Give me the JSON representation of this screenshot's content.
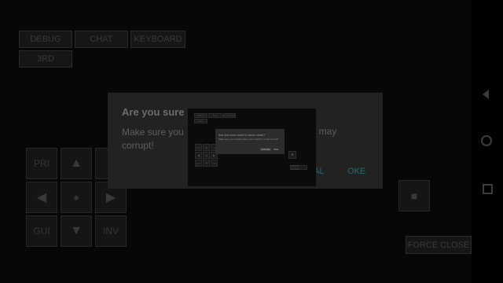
{
  "top_buttons": {
    "debug": "DEBUG",
    "chat": "CHAT",
    "keyboard": "KEYBOARD",
    "third_person": "3RD"
  },
  "dpad": {
    "pri": "PRI",
    "sec": "S",
    "gui": "GUI",
    "inv": "INV",
    "up": "▲",
    "down": "▼",
    "left": "◀",
    "right": "▶",
    "center": "◆"
  },
  "action_button_glyph": "■",
  "force_close_label": "FORCE CLOSE",
  "dialog": {
    "title": "Are you sure",
    "message": "Make sure you",
    "message_cont": "corrupt!",
    "message_tail": "t may",
    "cancel_label": "AL",
    "ok_label": "OKE"
  },
  "inner_dialog": {
    "title": "Are you sure want to force close?",
    "message": "Make sure you already close your world or it may corrupt!",
    "cancel_label": "CANCEL",
    "ok_label": "OKE"
  },
  "colors": {
    "background": "#070707",
    "dialog": "#222222",
    "accent": "#1f6d6d"
  }
}
